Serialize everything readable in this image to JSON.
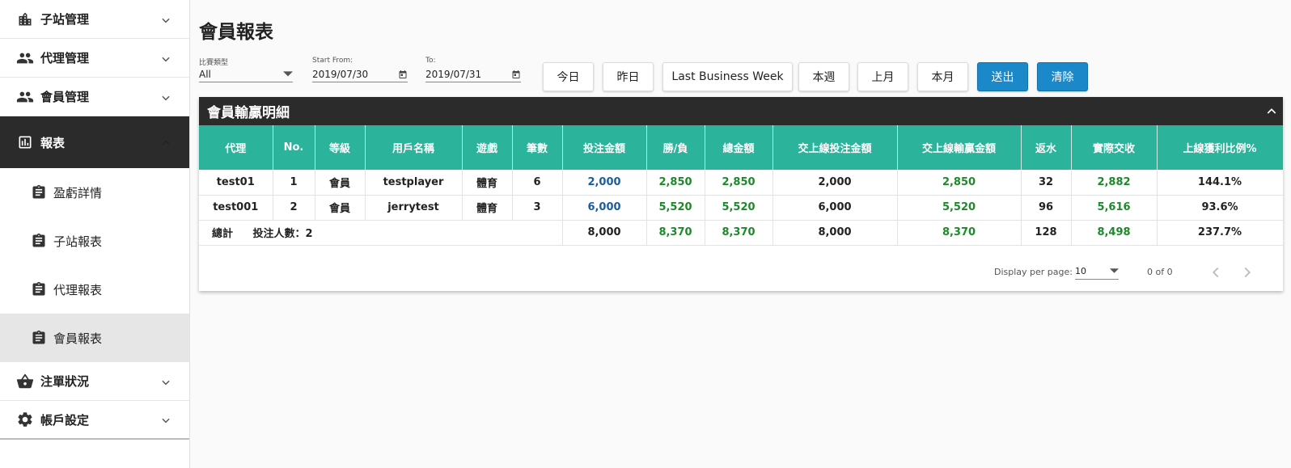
{
  "sidebar": {
    "items": [
      {
        "label": "子站管理",
        "icon": "building-icon"
      },
      {
        "label": "代理管理",
        "icon": "people-icon"
      },
      {
        "label": "會員管理",
        "icon": "people-icon"
      },
      {
        "label": "報表",
        "icon": "chart-icon"
      },
      {
        "label": "注單狀況",
        "icon": "basket-icon"
      },
      {
        "label": "帳戶設定",
        "icon": "gear-icon"
      }
    ],
    "sub_items": [
      {
        "label": "盈虧詳情"
      },
      {
        "label": "子站報表"
      },
      {
        "label": "代理報表"
      },
      {
        "label": "會員報表"
      }
    ]
  },
  "page": {
    "title": "會員報表"
  },
  "filters": {
    "type_label": "比賽類型",
    "type_value": "All",
    "start_label": "Start From:",
    "start_value": "2019/07/30",
    "end_label": "To:",
    "end_value": "2019/07/31"
  },
  "buttons": {
    "today": "今日",
    "yesterday": "昨日",
    "last_business_week": "Last Business Week",
    "this_week": "本週",
    "last_month": "上月",
    "this_month": "本月",
    "submit": "送出",
    "clear": "清除"
  },
  "panel": {
    "title": "會員輸贏明細"
  },
  "table": {
    "headers": [
      "代理",
      "No.",
      "等級",
      "用戶名稱",
      "遊戲",
      "筆數",
      "投注金額",
      "勝/負",
      "總金額",
      "交上線投注金額",
      "交上線輸贏金額",
      "返水",
      "實際交收",
      "上線獲利比例%"
    ],
    "rows": [
      [
        "test01",
        "1",
        "會員",
        "testplayer",
        "體育",
        "6",
        "2,000",
        "2,850",
        "2,850",
        "2,000",
        "2,850",
        "32",
        "2,882",
        "144.1%"
      ],
      [
        "test001",
        "2",
        "會員",
        "jerrytest",
        "體育",
        "3",
        "6,000",
        "5,520",
        "5,520",
        "6,000",
        "5,520",
        "96",
        "5,616",
        "93.6%"
      ]
    ],
    "total": {
      "label": "總計",
      "bettors": "投注人數：2",
      "values": [
        "8,000",
        "8,370",
        "8,370",
        "8,000",
        "8,370",
        "128",
        "8,498",
        "237.7%"
      ]
    }
  },
  "pagination": {
    "per_page_label": "Display per page:",
    "per_page_value": "10",
    "count": "0 of 0"
  },
  "colors": {
    "header_teal": "#2bb39b",
    "dark": "#2b2b2b",
    "blue_button": "#1b88c9",
    "value_blue": "#1a5d9e",
    "value_green": "#1d8a2a"
  }
}
